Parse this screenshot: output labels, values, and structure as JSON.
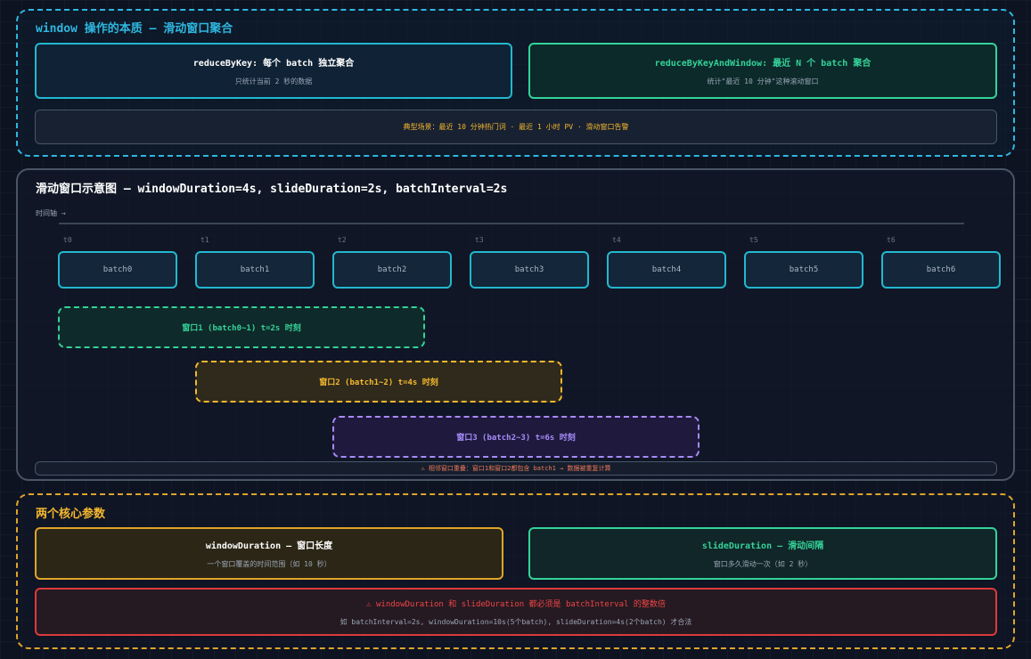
{
  "section1": {
    "title": "window 操作的本质 — 滑动窗口聚合",
    "reduce_by_key": {
      "title": "reduceByKey: 每个 batch 独立聚合",
      "desc": "只统计当前 2 秒的数据"
    },
    "reduce_by_key_and_window": {
      "title": "reduceByKeyAndWindow: 最近 N 个 batch 聚合",
      "desc": "统计\"最近 10 分钟\"这种滚动窗口"
    },
    "scenario": "典型场景：最近 10 分钟热门词 · 最近 1 小时 PV · 滑动窗口告警"
  },
  "section2": {
    "title": "滑动窗口示意图 — windowDuration=4s, slideDuration=2s, batchInterval=2s",
    "timeline_label": "时间轴 →",
    "ticks": [
      "t0",
      "t1",
      "t2",
      "t3",
      "t4",
      "t5",
      "t6"
    ],
    "batches": [
      "batch0",
      "batch1",
      "batch2",
      "batch3",
      "batch4",
      "batch5",
      "batch6"
    ],
    "windows": [
      {
        "label": "窗口1 (batch0~1) t=2s 时刻",
        "color": "#34d399"
      },
      {
        "label": "窗口2 (batch1~2) t=4s 时刻",
        "color": "#f5b82e"
      },
      {
        "label": "窗口3 (batch2~3) t=6s 时刻",
        "color": "#a78bfa"
      }
    ],
    "overlap_note": "⚠ 相邻窗口重叠：窗口1和窗口2都包含 batch1 → 数据被重复计算"
  },
  "section3": {
    "title": "两个核心参数",
    "window_duration": {
      "title": "windowDuration — 窗口长度",
      "desc": "一个窗口覆盖的时间范围（如 10 秒）"
    },
    "slide_duration": {
      "title": "slideDuration — 滑动间隔",
      "desc": "窗口多久滑动一次（如 2 秒）"
    },
    "warning": {
      "title": "⚠ windowDuration 和 slideDuration 都必须是 batchInterval 的整数倍",
      "example": "如 batchInterval=2s, windowDuration=10s(5个batch), slideDuration=4s(2个batch) 才合法"
    }
  },
  "colors": {
    "cyan": "#2fb7e0",
    "green": "#34d399",
    "amber": "#f5b82e",
    "purple": "#a78bfa",
    "red": "#ef4444"
  }
}
